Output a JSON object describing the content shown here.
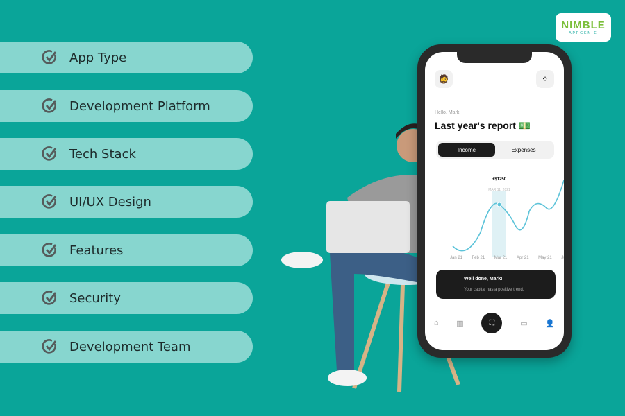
{
  "colors": {
    "background": "#0aa599",
    "pill": "#87d6cf",
    "check": "#555b5b"
  },
  "items": [
    {
      "label": "App Type",
      "icon": "check-circle-icon"
    },
    {
      "label": "Development Platform",
      "icon": "check-circle-icon"
    },
    {
      "label": "Tech Stack",
      "icon": "check-circle-icon"
    },
    {
      "label": "UI/UX Design",
      "icon": "check-circle-icon"
    },
    {
      "label": "Features",
      "icon": "check-circle-icon"
    },
    {
      "label": "Security",
      "icon": "check-circle-icon"
    },
    {
      "label": "Development Team",
      "icon": "check-circle-icon"
    }
  ],
  "logo": {
    "line1": "NIMBLE",
    "line2": "APPGENIE"
  },
  "phone": {
    "greeting": "Hello, Mark!",
    "title": "Last year's report 💵",
    "tabs": [
      "Income",
      "Expenses"
    ],
    "tooltip": {
      "value": "+$1250",
      "date": "MAR 11, 2021"
    },
    "months": [
      "Jan 21",
      "Feb 21",
      "Mar 21",
      "Apr 21",
      "May 21",
      "Jun"
    ],
    "card": {
      "title": "Well done, Mark!",
      "text": "Your capital has a positive trend.",
      "icon": "clapping-hands-icon"
    }
  }
}
